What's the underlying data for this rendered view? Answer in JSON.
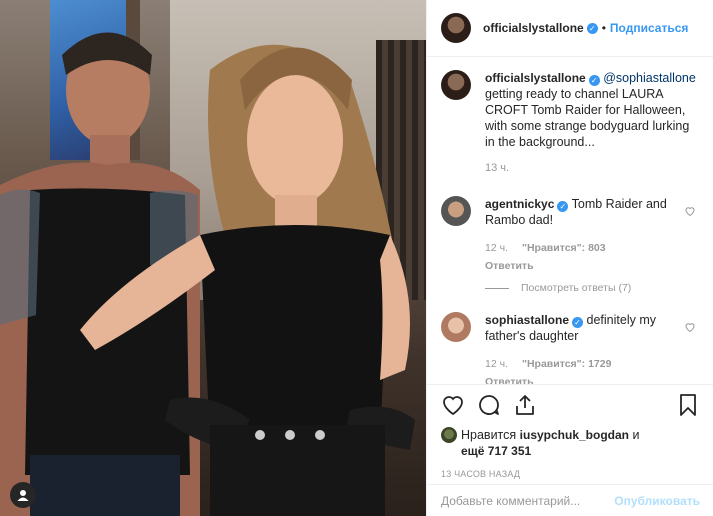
{
  "post": {
    "author": "officialslystallone",
    "dot": "•",
    "follow_label": "Подписаться",
    "caption_mention": "@sophiastallone",
    "caption_text": "getting ready to channel LAURA CROFT Tomb Raider for Halloween, with some strange bodyguard lurking in the background...",
    "caption_time": "13 ч."
  },
  "comments": [
    {
      "user": "agentnickyc",
      "text": "Tomb Raider and Rambo dad!",
      "time": "12 ч.",
      "likes": "\"Нравится\": 803",
      "reply": "Ответить",
      "view_replies": "Посмотреть ответы (7)"
    },
    {
      "user": "sophiastallone",
      "text": "definitely my father's daughter",
      "time": "12 ч.",
      "likes": "\"Нравится\": 1729",
      "reply": "Ответить"
    }
  ],
  "likes": {
    "prefix": "Нравится",
    "user": "iusypchuk_bogdan",
    "and": "и",
    "more": "ещё 717 351"
  },
  "timestamp": "13 ЧАСОВ НАЗАД",
  "add_comment": {
    "placeholder": "Добавьте комментарий...",
    "publish_label": "Опубликовать"
  },
  "icons": [
    "heart-icon",
    "comment-icon",
    "share-icon",
    "bookmark-icon",
    "verified-icon",
    "user-tag-icon"
  ],
  "colors": {
    "link": "#3897f0",
    "muted": "#999999",
    "text": "#262626",
    "publish_disabled": "#b2dffc"
  }
}
